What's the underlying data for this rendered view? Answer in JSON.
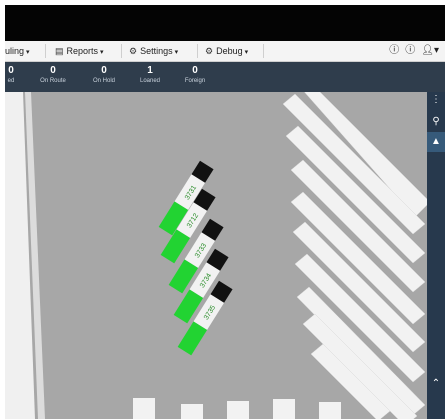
{
  "menubar": {
    "scheduling_label": "uling",
    "reports_label": "Reports",
    "settings_label": "Settings",
    "debug_label": "Debug"
  },
  "status": [
    {
      "value": "0",
      "label": "ed"
    },
    {
      "value": "0",
      "label": "On Route"
    },
    {
      "value": "0",
      "label": "On Hold"
    },
    {
      "value": "1",
      "label": "Loaned"
    },
    {
      "value": "0",
      "label": "Foreign"
    }
  ],
  "vehicles": [
    {
      "number": "3731"
    },
    {
      "number": "3712"
    },
    {
      "number": "3733"
    },
    {
      "number": "3734"
    },
    {
      "number": "3735"
    }
  ],
  "colors": {
    "statusbar": "#2f3d4c",
    "map_bg": "#a7a7a7",
    "vehicle_green": "#22d332",
    "sidebar": "#27394d"
  }
}
